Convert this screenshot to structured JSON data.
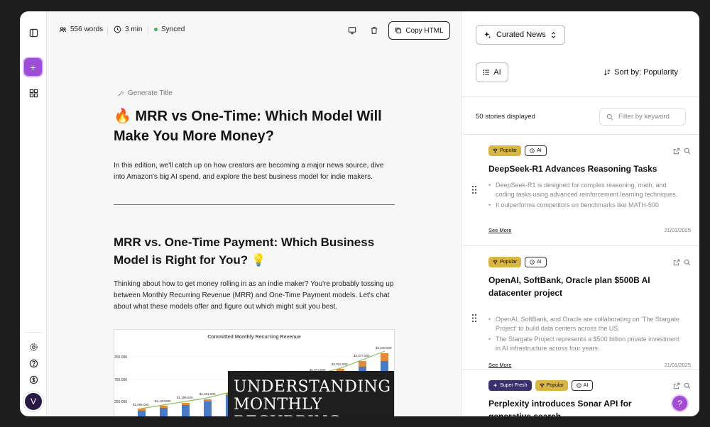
{
  "toolbar": {
    "words": "556 words",
    "read_time": "3 min",
    "sync_status": "Synced",
    "copy_label": "Copy HTML"
  },
  "sidebar": {
    "add_label": "+",
    "avatar_initial": "V"
  },
  "editor": {
    "generate_title": "Generate Title",
    "title": "🔥 MRR vs One-Time: Which Model Will Make You More Money?",
    "intro": "In this edition, we'll catch up on how creators are becoming a major news source, dive into Amazon's big AI spend, and explore the best business model for indie makers.",
    "section_title": "MRR vs. One-Time Payment: Which Business Model is Right for You? 💡",
    "section_body": "Thinking about how to get money rolling in as an indie maker? You're probably tossing up between Monthly Recurring Revenue (MRR) and One-Time Payment models. Let's chat about what these models offer and figure out which might suit you best.",
    "image": {
      "chart_title": "Committed Monthly Recurring Revenue",
      "overlay_text": "UNDERSTANDING MONTHLY RECURRING",
      "y_ticks": [
        "250,000",
        "750,000",
        "250,000"
      ],
      "data_labels": [
        "$1,055,000",
        "$1,120,500",
        "$1,196,500",
        "$1,281,000",
        "$1,873,000",
        "$2,022,500",
        "$2,377,500",
        "$2,548,000"
      ]
    }
  },
  "panel": {
    "source": "Curated News",
    "filter_tag": "AI",
    "sort": "Sort by: Popularity",
    "count": "50 stories displayed",
    "filter_placeholder": "Filter by keyword",
    "stories": [
      {
        "badges": [
          "Popular",
          "AI"
        ],
        "title": "DeepSeek-R1 Advances Reasoning Tasks",
        "bullets": [
          "DeepSeek-R1 is designed for complex reasoning, math, and coding tasks using advanced reinforcement learning techniques.",
          "It outperforms competitors on benchmarks like MATH-500"
        ],
        "see_more": "See More",
        "date": "21/01/2025"
      },
      {
        "badges": [
          "Popular",
          "AI"
        ],
        "title": "OpenAI, SoftBank, Oracle plan $500B AI datacenter project",
        "bullets": [
          "OpenAI, SoftBank, and Oracle are collaborating on 'The Stargate Project' to build data centers across the US.",
          "The Stargate Project represents a $500 billion private investment in AI infrastructure across four years."
        ],
        "see_more": "See More",
        "date": "21/01/2025"
      },
      {
        "badges": [
          "Super Fresh",
          "Popular",
          "AI"
        ],
        "title": "Perplexity introduces Sonar API for generative search"
      }
    ]
  },
  "help_label": "?"
}
